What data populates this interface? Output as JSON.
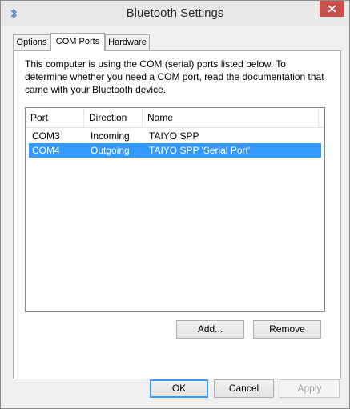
{
  "window": {
    "title": "Bluetooth Settings"
  },
  "tabs": [
    {
      "label": "Options"
    },
    {
      "label": "COM Ports"
    },
    {
      "label": "Hardware"
    }
  ],
  "description": "This computer is using the COM (serial) ports listed below. To determine whether you need a COM port, read the documentation that came with your Bluetooth device.",
  "ports_table": {
    "columns": [
      "Port",
      "Direction",
      "Name"
    ],
    "rows": [
      {
        "port": "COM3",
        "direction": "Incoming",
        "name": "TAIYO SPP",
        "selected": false
      },
      {
        "port": "COM4",
        "direction": "Outgoing",
        "name": "TAIYO SPP 'Serial Port'",
        "selected": true
      }
    ]
  },
  "actions": {
    "add_label": "Add...",
    "remove_label": "Remove"
  },
  "footer": {
    "ok_label": "OK",
    "cancel_label": "Cancel",
    "apply_label": "Apply"
  },
  "colors": {
    "selection": "#3399ff",
    "close_button": "#c7504b"
  },
  "icons": {
    "title": "bluetooth-icon",
    "close": "close-icon"
  }
}
